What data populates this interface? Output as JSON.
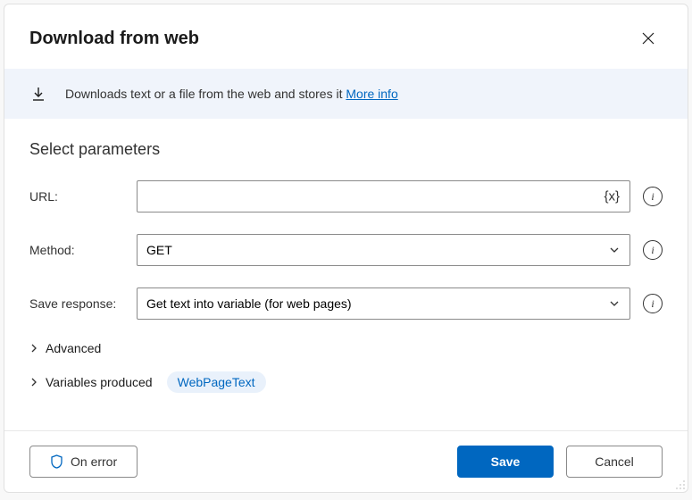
{
  "dialog": {
    "title": "Download from web"
  },
  "banner": {
    "text": "Downloads text or a file from the web and stores it ",
    "more_info": "More info"
  },
  "params": {
    "section_title": "Select parameters",
    "url_label": "URL:",
    "url_value": "",
    "var_token": "{x}",
    "method_label": "Method:",
    "method_value": "GET",
    "save_label": "Save response:",
    "save_value": "Get text into variable (for web pages)",
    "advanced_label": "Advanced",
    "variables_label": "Variables produced",
    "variable_chip": "WebPageText"
  },
  "footer": {
    "on_error": "On error",
    "save": "Save",
    "cancel": "Cancel"
  }
}
